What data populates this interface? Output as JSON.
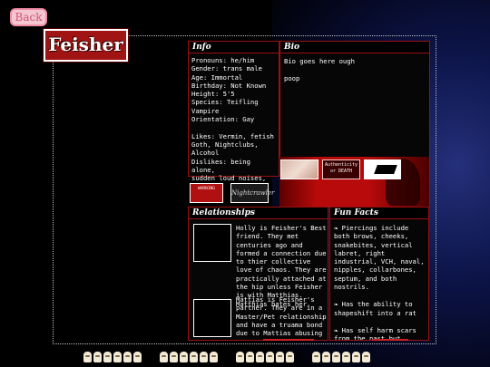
{
  "back": {
    "label": "Back"
  },
  "profile": {
    "name": "Feisher",
    "info": {
      "title": "Info",
      "text": "Pronouns: he/him\nGender: trans male\nAge: Immortal\nBirthday: Not Known\nHeight: 5'5\nSpecies: Teifling\nVampire\nOrientation: Gay\n\nLikes: Vermin, fetish\nGoth, Nightclubs,\nAlcohol\nDislikes: being alone,\nsudden loud noises,\ndaylight"
    },
    "bio": {
      "title": "Bio",
      "text": "Bio goes here ough\n\npoop"
    },
    "stamps": [
      {
        "label": ""
      },
      {
        "label": "Authenticity or DEATH"
      },
      {
        "label": ""
      },
      {
        "label": "WARNING"
      },
      {
        "label": "Nightcrawler"
      }
    ],
    "relationships": {
      "title": "Relationships",
      "entries": [
        {
          "text": "Holly is Feisher's Best friend. They met centuries ago and formed a connection due to thier collective love of chaos. They are practically attached at the hip unless Feisher is with Matthias. Matthias hates her."
        },
        {
          "text": "Mattias is Feisher's partner. They are in a Master/Pet relationship and have a truama bond due to Mattias abusing"
        }
      ]
    },
    "fun_facts": {
      "title": "Fun Facts",
      "items": [
        {
          "text": "Piercings include both brows, cheeks, snakebites, vertical labret, right industrial, VCH, naval, nipples, collarbones, septum, and both nostrils."
        },
        {
          "text": "Has the ability to shapeshift into a rat"
        },
        {
          "text": "Has self harm scars from the past but sometimes has fresh"
        }
      ]
    }
  },
  "colors": {
    "accent_red": "#9a1010",
    "back_button_bg": "#f4c6cf",
    "title_bg": "#a01414",
    "background": "#000000"
  }
}
